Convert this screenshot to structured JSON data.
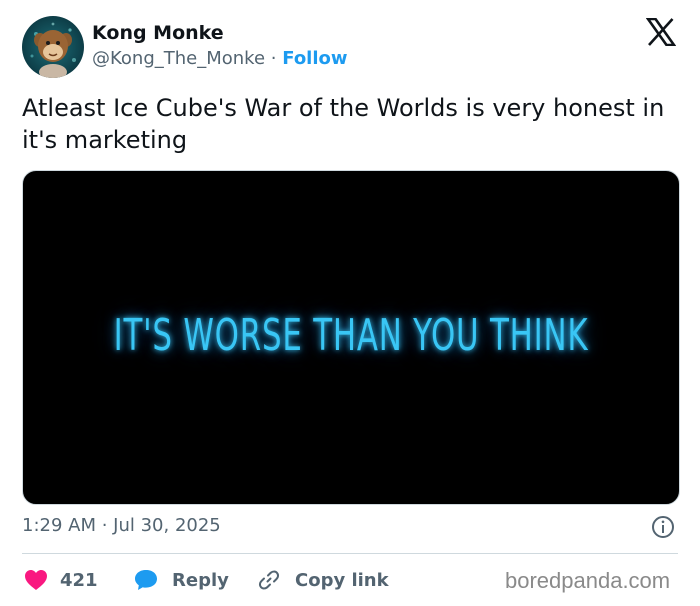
{
  "author": {
    "name": "Kong Monke",
    "handle": "@Kong_The_Monke",
    "separator": "·",
    "follow_label": "Follow",
    "avatar_icon": "monkey-plush-avatar"
  },
  "platform_icon": "x-logo-icon",
  "tweet": {
    "text": "Atleast Ice Cube's War of the Worlds is very honest in it's marketing"
  },
  "media": {
    "caption_text": "IT'S WORSE THAN YOU THINK",
    "text_color": "#39c6f5",
    "background": "#000000"
  },
  "meta": {
    "timestamp": "1:29 AM · Jul 30, 2025",
    "info_icon": "info-icon"
  },
  "actions": {
    "like_count": "421",
    "reply_label": "Reply",
    "copy_link_label": "Copy link"
  },
  "colors": {
    "accent": "#1d9bf0",
    "like": "#f91880",
    "text": "#0f1419",
    "secondary": "#536471"
  },
  "watermark": "boredpanda.com"
}
